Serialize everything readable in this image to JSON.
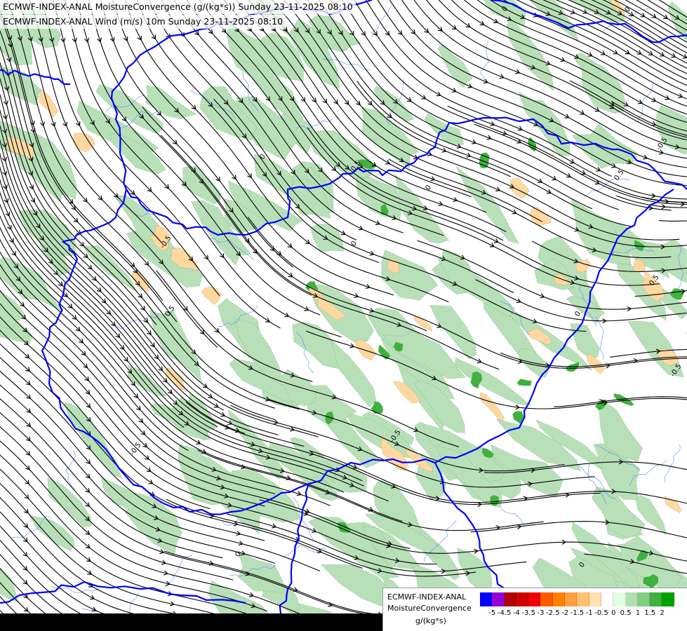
{
  "header": {
    "line1": "ECMWF-INDEX-ANAL MoistureConvergence (g/(kg*s)) Sunday 23-11-2025 08:10",
    "line2": "ECMWF-INDEX-ANAL Wind (m/s) 10m Sunday 23-11-2025 08:10"
  },
  "map": {
    "contour_labels": [
      "0",
      "-0.5",
      "0.5",
      "-0.5",
      "0.5",
      "0",
      "0.5",
      "-0.5",
      "0.5",
      "-0.5",
      "0",
      "0",
      "0",
      "0",
      "0",
      "0",
      "-0.5"
    ]
  },
  "legend": {
    "model": "ECMWF-INDEX-ANAL",
    "parameter": "MoistureConvergence",
    "unit": "g/(kg*s)",
    "colors": [
      "#0000ff",
      "#9400d3",
      "#b00000",
      "#d00000",
      "#f00000",
      "#ff5a00",
      "#ff8000",
      "#ffa040",
      "#ffc070",
      "#ffe0b0",
      "#ffffff",
      "#e0ffe0",
      "#b0e0b0",
      "#80d080",
      "#40b040",
      "#00a000"
    ],
    "ticks": [
      "-5",
      "-4.5",
      "-4",
      "-3.5",
      "-3",
      "-2.5",
      "-2",
      "-1.5",
      "-1",
      "-0.5",
      "0",
      "0.5",
      "1",
      "1.5",
      "2"
    ]
  },
  "colors": {
    "border": "#0000ff",
    "river": "#5080ff",
    "streamline": "#000000",
    "positive_fill": "#b8e0b8",
    "strong_positive_fill": "#40b040",
    "negative_fill": "#ffd8a0"
  }
}
